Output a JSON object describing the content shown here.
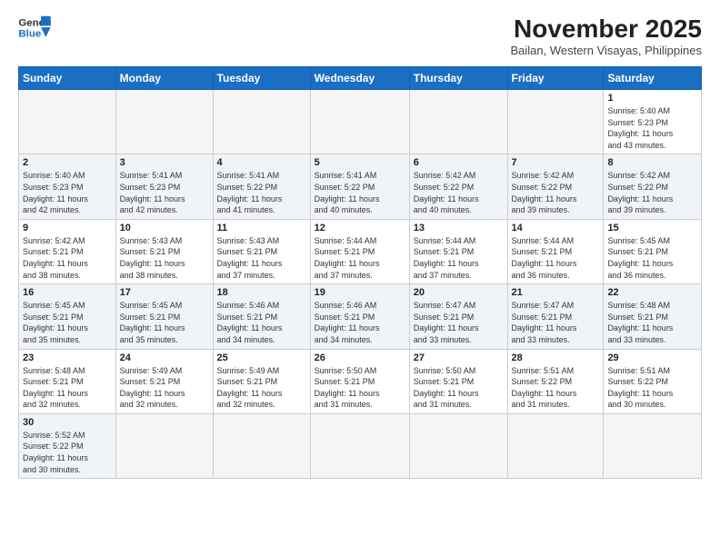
{
  "header": {
    "logo_general": "General",
    "logo_blue": "Blue",
    "month_title": "November 2025",
    "location": "Bailan, Western Visayas, Philippines"
  },
  "weekdays": [
    "Sunday",
    "Monday",
    "Tuesday",
    "Wednesday",
    "Thursday",
    "Friday",
    "Saturday"
  ],
  "weeks": [
    [
      {
        "day": "",
        "info": ""
      },
      {
        "day": "",
        "info": ""
      },
      {
        "day": "",
        "info": ""
      },
      {
        "day": "",
        "info": ""
      },
      {
        "day": "",
        "info": ""
      },
      {
        "day": "",
        "info": ""
      },
      {
        "day": "1",
        "info": "Sunrise: 5:40 AM\nSunset: 5:23 PM\nDaylight: 11 hours\nand 43 minutes."
      }
    ],
    [
      {
        "day": "2",
        "info": "Sunrise: 5:40 AM\nSunset: 5:23 PM\nDaylight: 11 hours\nand 42 minutes."
      },
      {
        "day": "3",
        "info": "Sunrise: 5:41 AM\nSunset: 5:23 PM\nDaylight: 11 hours\nand 42 minutes."
      },
      {
        "day": "4",
        "info": "Sunrise: 5:41 AM\nSunset: 5:22 PM\nDaylight: 11 hours\nand 41 minutes."
      },
      {
        "day": "5",
        "info": "Sunrise: 5:41 AM\nSunset: 5:22 PM\nDaylight: 11 hours\nand 40 minutes."
      },
      {
        "day": "6",
        "info": "Sunrise: 5:42 AM\nSunset: 5:22 PM\nDaylight: 11 hours\nand 40 minutes."
      },
      {
        "day": "7",
        "info": "Sunrise: 5:42 AM\nSunset: 5:22 PM\nDaylight: 11 hours\nand 39 minutes."
      },
      {
        "day": "8",
        "info": "Sunrise: 5:42 AM\nSunset: 5:22 PM\nDaylight: 11 hours\nand 39 minutes."
      }
    ],
    [
      {
        "day": "9",
        "info": "Sunrise: 5:42 AM\nSunset: 5:21 PM\nDaylight: 11 hours\nand 38 minutes."
      },
      {
        "day": "10",
        "info": "Sunrise: 5:43 AM\nSunset: 5:21 PM\nDaylight: 11 hours\nand 38 minutes."
      },
      {
        "day": "11",
        "info": "Sunrise: 5:43 AM\nSunset: 5:21 PM\nDaylight: 11 hours\nand 37 minutes."
      },
      {
        "day": "12",
        "info": "Sunrise: 5:44 AM\nSunset: 5:21 PM\nDaylight: 11 hours\nand 37 minutes."
      },
      {
        "day": "13",
        "info": "Sunrise: 5:44 AM\nSunset: 5:21 PM\nDaylight: 11 hours\nand 37 minutes."
      },
      {
        "day": "14",
        "info": "Sunrise: 5:44 AM\nSunset: 5:21 PM\nDaylight: 11 hours\nand 36 minutes."
      },
      {
        "day": "15",
        "info": "Sunrise: 5:45 AM\nSunset: 5:21 PM\nDaylight: 11 hours\nand 36 minutes."
      }
    ],
    [
      {
        "day": "16",
        "info": "Sunrise: 5:45 AM\nSunset: 5:21 PM\nDaylight: 11 hours\nand 35 minutes."
      },
      {
        "day": "17",
        "info": "Sunrise: 5:45 AM\nSunset: 5:21 PM\nDaylight: 11 hours\nand 35 minutes."
      },
      {
        "day": "18",
        "info": "Sunrise: 5:46 AM\nSunset: 5:21 PM\nDaylight: 11 hours\nand 34 minutes."
      },
      {
        "day": "19",
        "info": "Sunrise: 5:46 AM\nSunset: 5:21 PM\nDaylight: 11 hours\nand 34 minutes."
      },
      {
        "day": "20",
        "info": "Sunrise: 5:47 AM\nSunset: 5:21 PM\nDaylight: 11 hours\nand 33 minutes."
      },
      {
        "day": "21",
        "info": "Sunrise: 5:47 AM\nSunset: 5:21 PM\nDaylight: 11 hours\nand 33 minutes."
      },
      {
        "day": "22",
        "info": "Sunrise: 5:48 AM\nSunset: 5:21 PM\nDaylight: 11 hours\nand 33 minutes."
      }
    ],
    [
      {
        "day": "23",
        "info": "Sunrise: 5:48 AM\nSunset: 5:21 PM\nDaylight: 11 hours\nand 32 minutes."
      },
      {
        "day": "24",
        "info": "Sunrise: 5:49 AM\nSunset: 5:21 PM\nDaylight: 11 hours\nand 32 minutes."
      },
      {
        "day": "25",
        "info": "Sunrise: 5:49 AM\nSunset: 5:21 PM\nDaylight: 11 hours\nand 32 minutes."
      },
      {
        "day": "26",
        "info": "Sunrise: 5:50 AM\nSunset: 5:21 PM\nDaylight: 11 hours\nand 31 minutes."
      },
      {
        "day": "27",
        "info": "Sunrise: 5:50 AM\nSunset: 5:21 PM\nDaylight: 11 hours\nand 31 minutes."
      },
      {
        "day": "28",
        "info": "Sunrise: 5:51 AM\nSunset: 5:22 PM\nDaylight: 11 hours\nand 31 minutes."
      },
      {
        "day": "29",
        "info": "Sunrise: 5:51 AM\nSunset: 5:22 PM\nDaylight: 11 hours\nand 30 minutes."
      }
    ],
    [
      {
        "day": "30",
        "info": "Sunrise: 5:52 AM\nSunset: 5:22 PM\nDaylight: 11 hours\nand 30 minutes."
      },
      {
        "day": "",
        "info": ""
      },
      {
        "day": "",
        "info": ""
      },
      {
        "day": "",
        "info": ""
      },
      {
        "day": "",
        "info": ""
      },
      {
        "day": "",
        "info": ""
      },
      {
        "day": "",
        "info": ""
      }
    ]
  ]
}
